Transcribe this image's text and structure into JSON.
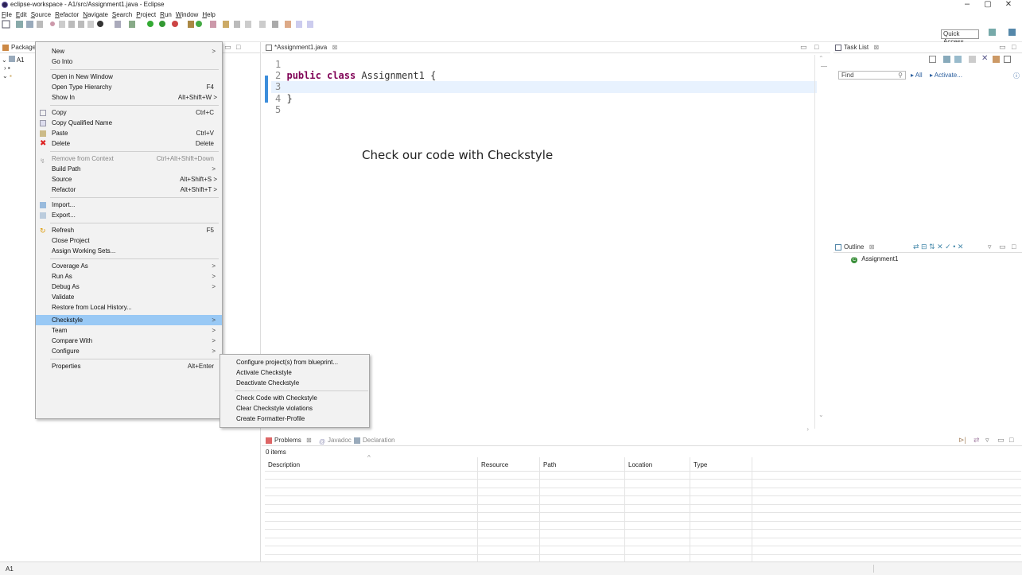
{
  "window": {
    "title": "eclipse-workspace - A1/src/Assignment1.java - Eclipse",
    "minimize": "–",
    "maximize": "▢",
    "close": "✕"
  },
  "menubar": [
    "File",
    "Edit",
    "Source",
    "Refactor",
    "Navigate",
    "Search",
    "Project",
    "Run",
    "Window",
    "Help"
  ],
  "toolbar": {
    "quick_access": "Quick Access"
  },
  "package_explorer": {
    "tab_label": "Package Explorer",
    "tree_root": "A1"
  },
  "editor": {
    "tab_label": "*Assignment1.java",
    "lines": [
      {
        "num": "1",
        "pre": "",
        "kw": "",
        "rest": ""
      },
      {
        "num": "2",
        "pre": "",
        "kw": "public class",
        "rest": " Assignment1 {"
      },
      {
        "num": "3",
        "pre": "",
        "kw": "",
        "rest": ""
      },
      {
        "num": "4",
        "pre": "",
        "kw": "",
        "rest": "}"
      },
      {
        "num": "5",
        "pre": "",
        "kw": "",
        "rest": ""
      }
    ],
    "annotation": "Check our code with Checkstyle"
  },
  "task_list": {
    "tab_label": "Task List",
    "find_placeholder": "Find",
    "all_label": "All",
    "activate_label": "Activate..."
  },
  "outline": {
    "tab_label": "Outline",
    "item": "Assignment1"
  },
  "problems": {
    "tabs": [
      "Problems",
      "Javadoc",
      "Declaration"
    ],
    "count": "0 items",
    "columns": [
      "Description",
      "Resource",
      "Path",
      "Location",
      "Type"
    ]
  },
  "status_bar": {
    "text": "A1"
  },
  "context_menu": {
    "items": [
      {
        "label": "New",
        "acc": "",
        "arrow": true
      },
      {
        "label": "Go Into",
        "acc": "",
        "arrow": false
      },
      {
        "label": "Open in New Window",
        "acc": "",
        "arrow": false
      },
      {
        "label": "Open Type Hierarchy",
        "acc": "F4",
        "arrow": false
      },
      {
        "label": "Show In",
        "acc": "Alt+Shift+W >",
        "arrow": false
      },
      {
        "label": "Copy",
        "acc": "Ctrl+C",
        "arrow": false
      },
      {
        "label": "Copy Qualified Name",
        "acc": "",
        "arrow": false
      },
      {
        "label": "Paste",
        "acc": "Ctrl+V",
        "arrow": false
      },
      {
        "label": "Delete",
        "acc": "Delete",
        "arrow": false
      },
      {
        "label": "Remove from Context",
        "acc": "Ctrl+Alt+Shift+Down",
        "arrow": false
      },
      {
        "label": "Build Path",
        "acc": "",
        "arrow": true
      },
      {
        "label": "Source",
        "acc": "Alt+Shift+S >",
        "arrow": false
      },
      {
        "label": "Refactor",
        "acc": "Alt+Shift+T >",
        "arrow": false
      },
      {
        "label": "Import...",
        "acc": "",
        "arrow": false
      },
      {
        "label": "Export...",
        "acc": "",
        "arrow": false
      },
      {
        "label": "Refresh",
        "acc": "F5",
        "arrow": false
      },
      {
        "label": "Close Project",
        "acc": "",
        "arrow": false
      },
      {
        "label": "Assign Working Sets...",
        "acc": "",
        "arrow": false
      },
      {
        "label": "Coverage As",
        "acc": "",
        "arrow": true
      },
      {
        "label": "Run As",
        "acc": "",
        "arrow": true
      },
      {
        "label": "Debug As",
        "acc": "",
        "arrow": true
      },
      {
        "label": "Validate",
        "acc": "",
        "arrow": false
      },
      {
        "label": "Restore from Local History...",
        "acc": "",
        "arrow": false
      },
      {
        "label": "Checkstyle",
        "acc": "",
        "arrow": true
      },
      {
        "label": "Team",
        "acc": "",
        "arrow": true
      },
      {
        "label": "Compare With",
        "acc": "",
        "arrow": true
      },
      {
        "label": "Configure",
        "acc": "",
        "arrow": true
      },
      {
        "label": "Properties",
        "acc": "Alt+Enter",
        "arrow": false
      }
    ],
    "arrow_glyph": ">"
  },
  "checkstyle_submenu": {
    "items": [
      "Configure project(s) from blueprint...",
      "Activate Checkstyle",
      "Deactivate Checkstyle",
      "Check Code with Checkstyle",
      "Clear Checkstyle violations",
      "Create Formatter-Profile"
    ]
  },
  "colors": {
    "menu_highlight": "#99c9f5",
    "menu_bg": "#f2f2f2",
    "current_line": "#e8f2fe",
    "keyword": "#7f0055"
  }
}
